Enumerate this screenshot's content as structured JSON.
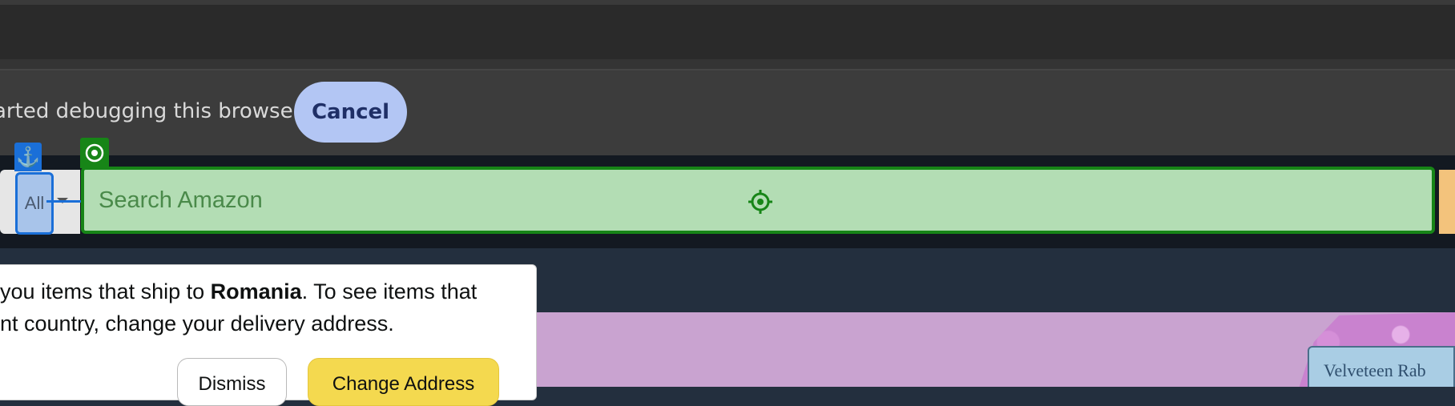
{
  "debug_bar": {
    "message": "arted debugging this browser",
    "cancel_label": "Cancel"
  },
  "search": {
    "department_label": "All",
    "placeholder": "Search Amazon"
  },
  "annotations": {
    "anchor_icon": "anchor-icon",
    "target_icon": "target-icon",
    "crosshair_icon": "crosshair-icon",
    "anchor_color": "#1a6fd8",
    "target_color": "#178517"
  },
  "delivery_popover": {
    "line1_prefix": "you items that ship to ",
    "line1_country": "Romania",
    "line1_suffix": ". To see items that",
    "line2": "nt country, change your delivery address.",
    "dismiss_label": "Dismiss",
    "change_label": "Change Address"
  },
  "hero": {
    "book_title": "Velveteen Rab"
  },
  "colors": {
    "amazon_header": "#131921",
    "amazon_nav": "#232f3e",
    "hero_bg": "#c9a3d0",
    "change_button": "#f4d94f"
  }
}
